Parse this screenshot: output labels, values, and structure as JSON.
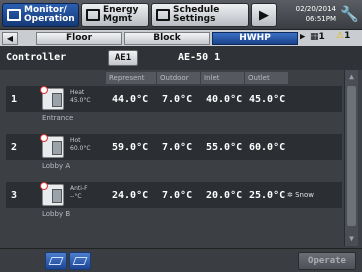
{
  "top": {
    "monitor_line1": "Monitor/",
    "monitor_line2": "Operation",
    "energy_line1": "Energy",
    "energy_line2": "Mgmt",
    "schedule_line1": "Schedule",
    "schedule_line2": "Settings",
    "play_icon": "▶",
    "date": "02/20/2014",
    "time": "06:51PM",
    "wrench_icon": "wrench-icon"
  },
  "tabs": {
    "prev": "◀",
    "floor": "Floor",
    "block": "Block",
    "hwhp": "HWHP",
    "next": "▶",
    "group_count": "1",
    "alert_count": "1"
  },
  "controller": {
    "label": "Controller",
    "button": "AE1",
    "name": "AE-50 1"
  },
  "columns": {
    "represent": "Represent",
    "outdoor": "Outdoor",
    "inlet": "Inlet",
    "outlet": "Outlet"
  },
  "rows": [
    {
      "num": "1",
      "mode": "Heat",
      "setpoint": "45.0°C",
      "represent": "44.0°C",
      "outdoor": "7.0°C",
      "inlet": "40.0°C",
      "outlet": "45.0°C",
      "extra": "",
      "name": "Entrance"
    },
    {
      "num": "2",
      "mode": "Hot",
      "setpoint": "60.0°C",
      "represent": "59.0°C",
      "outdoor": "7.0°C",
      "inlet": "55.0°C",
      "outlet": "60.0°C",
      "extra": "",
      "name": "Lobby A"
    },
    {
      "num": "3",
      "mode": "Anti-F",
      "setpoint": "--°C",
      "represent": "24.0°C",
      "outdoor": "7.0°C",
      "inlet": "20.0°C",
      "outlet": "25.0°C",
      "extra": "Snow",
      "name": "Lobby B"
    }
  ],
  "bottom": {
    "operate": "Operate"
  },
  "colors": {
    "active_tab": "#1b438a",
    "alert": "#e8b800",
    "background": "#3c3f44"
  }
}
